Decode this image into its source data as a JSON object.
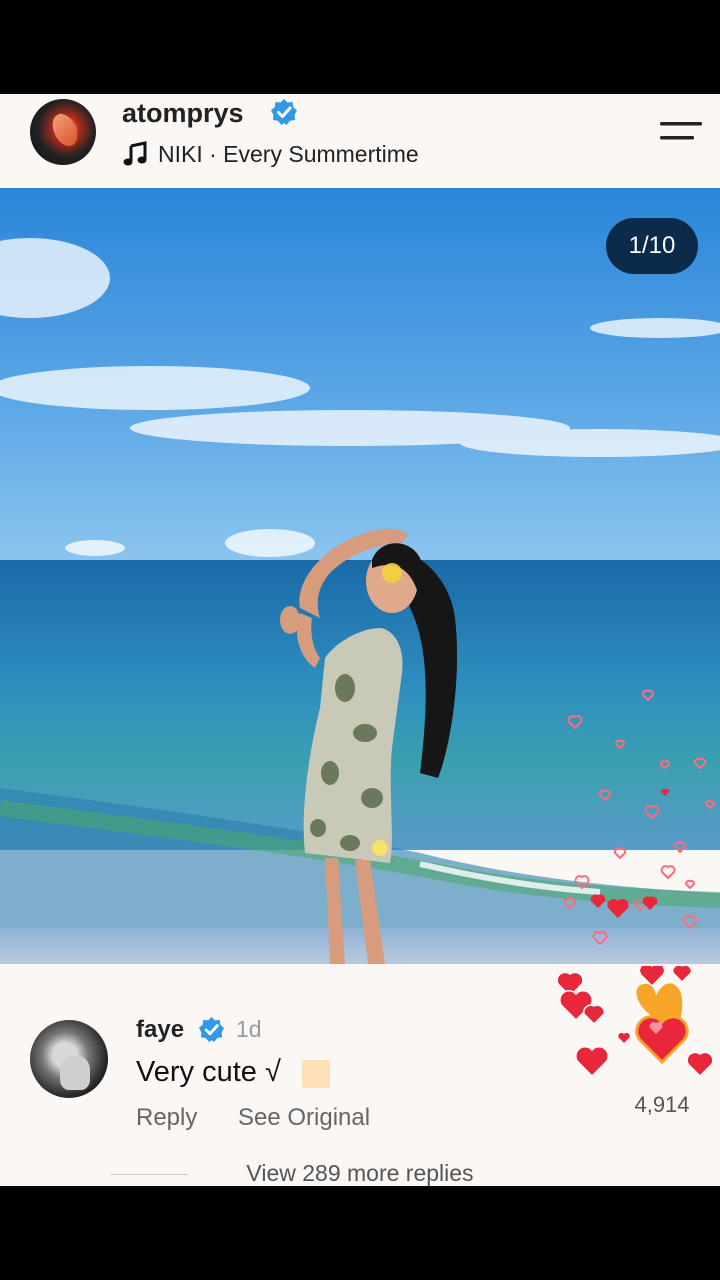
{
  "post": {
    "username": "atomprys",
    "music": "NIKI · Every Summertime",
    "image_counter": "1/10"
  },
  "comment": {
    "author": "faye",
    "time": "1d",
    "text": "Very cute √",
    "reply_label": "Reply",
    "see_original_label": "See Original",
    "like_count": "4,914",
    "more_replies": "View 289 more replies"
  },
  "icons": {
    "verified": "verified-badge-icon",
    "music": "music-note-icon",
    "menu": "menu-icon",
    "like": "heart-icon"
  },
  "colors": {
    "verified": "#2f9ae8",
    "counter_bg": "#0c2a4a",
    "heart": "#e8283a"
  }
}
